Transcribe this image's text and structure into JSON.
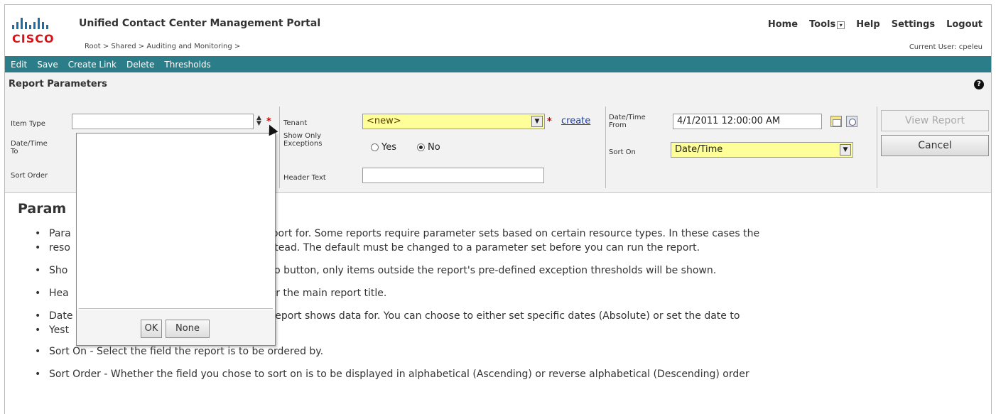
{
  "header": {
    "portal_title": "Unified Contact Center Management Portal",
    "brand": "CISCO",
    "breadcrumb": "Root > Shared > Auditing and Monitoring >",
    "nav": {
      "home": "Home",
      "tools": "Tools",
      "help": "Help",
      "settings": "Settings",
      "logout": "Logout"
    },
    "current_user": "Current User: cpeleu"
  },
  "toolbar": {
    "edit": "Edit",
    "save": "Save",
    "create_link": "Create Link",
    "delete": "Delete",
    "thresholds": "Thresholds"
  },
  "params": {
    "title": "Report Parameters",
    "item_type_label": "Item Type",
    "date_time_to_label": "Date/Time To",
    "sort_order_label": "Sort Order",
    "tenant_label": "Tenant",
    "tenant_value": "<new>",
    "create_link": "create",
    "show_only_exceptions_label": "Show Only Exceptions",
    "yes_label": "Yes",
    "no_label": "No",
    "header_text_label": "Header Text",
    "header_text_value": "",
    "date_time_from_label": "Date/Time From",
    "date_time_from_value": "4/1/2011 12:00:00 AM",
    "sort_on_label": "Sort On",
    "sort_on_value": "Date/Time",
    "view_report": "View Report",
    "cancel": "Cancel"
  },
  "content": {
    "title": "Param",
    "bullets": [
      "Para                                              view the report for. Some reports require parameter sets based on certain resource types. In these cases the",
      "reso                                              e shown instead. The default must be changed to a parameter set before you can run the report.",
      "Sho                                               the Yes radio button, only items outside the report's pre-defined exception thresholds will be shown.",
      "Hea                                              played under the main report title.",
      "Date                                              s that this report shows data for. You can choose to either set specific dates (Absolute) or set the date to",
      "Yest                                              tive).",
      "Sort On - Select the field the report is to be ordered by.",
      "Sort Order - Whether the field you chose to sort on is to be displayed in alphabetical (Ascending) or reverse alphabetical (Descending) order"
    ]
  },
  "popup": {
    "ok": "OK",
    "none": "None"
  }
}
